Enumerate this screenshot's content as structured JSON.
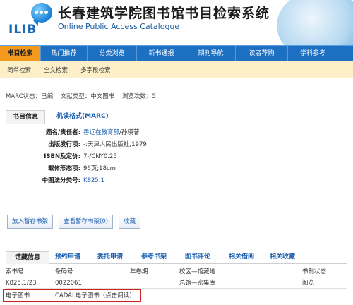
{
  "header": {
    "logo_text": "ILIB",
    "title": "长春建筑学院图书馆书目检索系统",
    "subtitle": "Online Public Access Catalogue"
  },
  "nav": {
    "items": [
      "书目检索",
      "热门推荐",
      "分类浏览",
      "新书通报",
      "期刊导航",
      "读者荐购",
      "学科参考"
    ],
    "active_index": 0,
    "sub_items": [
      "简单检索",
      "全文检索",
      "多字段检索"
    ]
  },
  "marc_info": {
    "status": "MARC状态：已编",
    "doc_type": "文献类型：中文图书",
    "views": "浏览次数：5"
  },
  "detail_tabs": [
    "书目信息",
    "机读格式(MARC)"
  ],
  "fields": [
    {
      "label": "题名/责任者:",
      "value_link": "香远在教育部",
      "value_rest": "/孙瑛著"
    },
    {
      "label": "出版发行项:",
      "value_link": "",
      "value_rest": "-:天津人民出版社,1979"
    },
    {
      "label": "ISBN及定价:",
      "value_link": "",
      "value_rest": "7-/CNY0.25"
    },
    {
      "label": "载体形态项:",
      "value_link": "",
      "value_rest": "96页;18cm"
    },
    {
      "label": "中图法分类号:",
      "value_link": "K825.1",
      "value_rest": ""
    }
  ],
  "buttons": [
    "放入暂存书架",
    "查看暂存书架(0)",
    "收藏"
  ],
  "holding_tabs": [
    "馆藏信息",
    "预约申请",
    "委托申请",
    "参考书架",
    "图书评论",
    "相关借阅",
    "相关收藏"
  ],
  "holdings": {
    "headers": [
      "索书号",
      "条码号",
      "年卷期",
      "校区—馆藏地",
      "书刊状态"
    ],
    "rows": [
      [
        "K825.1/23",
        "0022061",
        "",
        "总馆—密集库",
        "阅览"
      ]
    ],
    "ebook_label": "电子图书",
    "ebook_link": "CADAL电子图书（点击阅读）"
  },
  "colors": {
    "nav_bg": "#1d6fc2",
    "nav_active": "#f39a1e",
    "subnav_bg": "#fdf0c9",
    "link": "#1b5fb0",
    "highlight_border": "#d02020"
  }
}
